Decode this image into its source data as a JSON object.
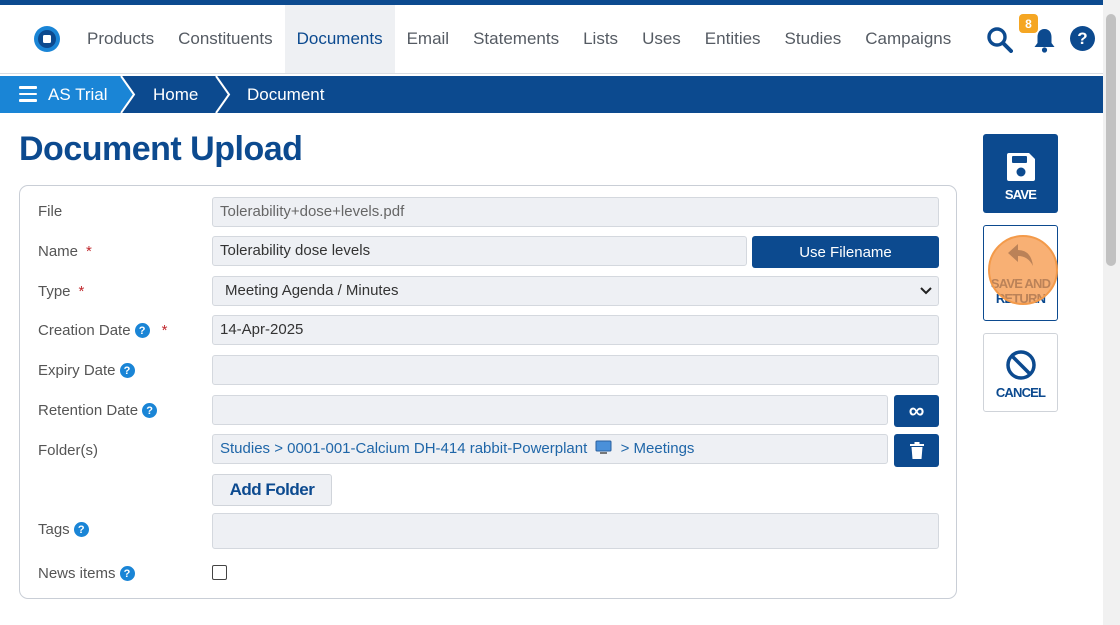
{
  "nav": {
    "items": [
      {
        "label": "Products",
        "active": false
      },
      {
        "label": "Constituents",
        "active": false
      },
      {
        "label": "Documents",
        "active": true
      },
      {
        "label": "Email",
        "active": false
      },
      {
        "label": "Statements",
        "active": false
      },
      {
        "label": "Lists",
        "active": false
      },
      {
        "label": "Uses",
        "active": false
      },
      {
        "label": "Entities",
        "active": false
      },
      {
        "label": "Studies",
        "active": false
      },
      {
        "label": "Campaigns",
        "active": false
      }
    ],
    "notification_count": "8",
    "icons": [
      "search-icon",
      "bell-icon",
      "help-icon"
    ]
  },
  "breadcrumb": {
    "items": [
      "AS Trial",
      "Home",
      "Document"
    ]
  },
  "page": {
    "title": "Document Upload"
  },
  "form": {
    "file": {
      "label": "File",
      "value": "Tolerability+dose+levels.pdf"
    },
    "name": {
      "label": "Name",
      "required": "*",
      "value": "Tolerability dose levels",
      "button": "Use Filename"
    },
    "type": {
      "label": "Type",
      "required": "*",
      "value": "Meeting Agenda / Minutes"
    },
    "creation_date": {
      "label": "Creation Date",
      "required": "*",
      "value": "14-Apr-2025"
    },
    "expiry_date": {
      "label": "Expiry Date",
      "value": ""
    },
    "retention_date": {
      "label": "Retention Date",
      "value": "",
      "button_symbol": "∞"
    },
    "folders": {
      "label": "Folder(s)",
      "path_start": "Studies > 0001-001-Calcium DH-414 rabbit-Powerplant",
      "path_end": "> Meetings",
      "add_button": "Add Folder"
    },
    "tags": {
      "label": "Tags",
      "value": ""
    },
    "news_items": {
      "label": "News items",
      "checked": false
    },
    "help_symbol": "?"
  },
  "actions": {
    "save": "SAVE",
    "save_and_return": "SAVE AND RETURN",
    "cancel": "CANCEL"
  },
  "colors": {
    "brand": "#0c4a8f",
    "accent": "#1a85d6",
    "badge": "#f5a623",
    "highlight": "#f39a4a"
  }
}
